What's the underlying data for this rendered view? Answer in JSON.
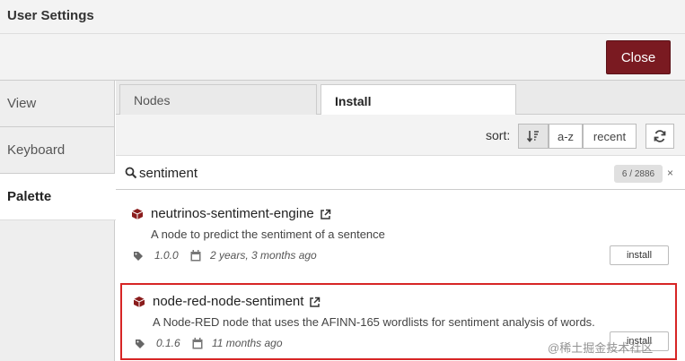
{
  "dialog": {
    "title": "User Settings",
    "close_label": "Close"
  },
  "sidebar": {
    "items": [
      {
        "label": "View"
      },
      {
        "label": "Keyboard"
      },
      {
        "label": "Palette"
      }
    ]
  },
  "tabs": [
    {
      "label": "Nodes"
    },
    {
      "label": "Install"
    }
  ],
  "toolbar": {
    "sort_label": "sort:",
    "sort_options": [
      "a-z",
      "recent"
    ],
    "refresh_icon": "refresh-icon",
    "relevance_icon": "sort-relevance-icon"
  },
  "search": {
    "value": "sentiment",
    "count": "6 / 2886",
    "clear": "×"
  },
  "results": [
    {
      "name": "neutrinos-sentiment-engine",
      "description": "A node to predict the sentiment of a sentence",
      "version": "1.0.0",
      "updated": "2 years, 3 months ago",
      "install_label": "install"
    },
    {
      "name": "node-red-node-sentiment",
      "description": "A Node-RED node that uses the AFINN-165 wordlists for sentiment analysis of words.",
      "version": "0.1.6",
      "updated": "11 months ago",
      "install_label": "install",
      "highlighted": true
    }
  ],
  "watermark": "@稀土掘金技术社区",
  "colors": {
    "accent": "#7a1a21",
    "highlight": "#d72525"
  }
}
